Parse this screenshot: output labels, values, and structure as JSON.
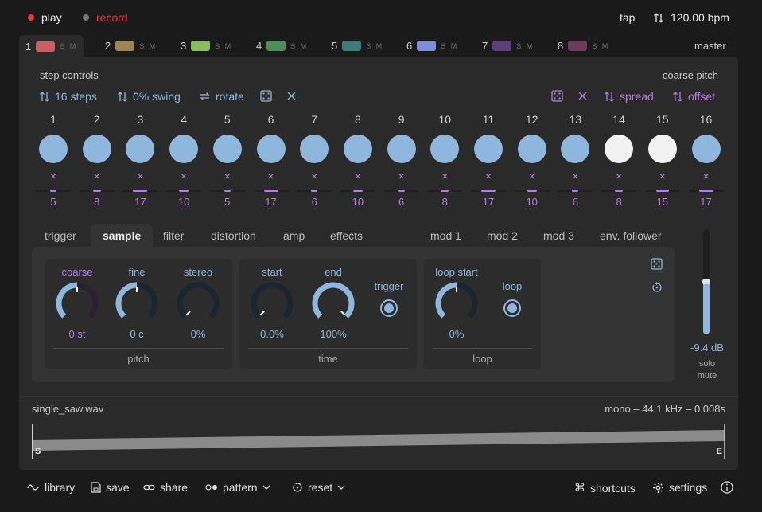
{
  "transport": {
    "play_label": "play",
    "record_label": "record",
    "tap_label": "tap",
    "bpm": "120.00 bpm",
    "colors": {
      "play_dot": "#e53935",
      "record_dot": "#777777",
      "record_text": "#e53935"
    }
  },
  "tracks": [
    {
      "num": "1",
      "color": "#c95f62",
      "sm": "S M"
    },
    {
      "num": "2",
      "color": "#9a8650",
      "sm": "S M"
    },
    {
      "num": "3",
      "color": "#8bbd5b",
      "sm": "S M"
    },
    {
      "num": "4",
      "color": "#4d8d5b",
      "sm": "S M"
    },
    {
      "num": "5",
      "color": "#3f7c79",
      "sm": "S M"
    },
    {
      "num": "6",
      "color": "#7d8dd8",
      "sm": "S M"
    },
    {
      "num": "7",
      "color": "#5c3f7a",
      "sm": "S M"
    },
    {
      "num": "8",
      "color": "#6b3d57",
      "sm": "S M"
    }
  ],
  "master_label": "master",
  "step_controls": {
    "title": "step controls",
    "steps_label": "16 steps",
    "swing_label": "0% swing",
    "rotate_label": "rotate",
    "coarse_pitch_title": "coarse pitch",
    "spread_label": "spread",
    "offset_label": "offset"
  },
  "steps": [
    {
      "num": "1",
      "underline": true,
      "active": false,
      "value": "5",
      "level": 0.2
    },
    {
      "num": "2",
      "underline": false,
      "active": false,
      "value": "8",
      "level": 0.25
    },
    {
      "num": "3",
      "underline": false,
      "active": false,
      "value": "17",
      "level": 0.45
    },
    {
      "num": "4",
      "underline": false,
      "active": false,
      "value": "10",
      "level": 0.3
    },
    {
      "num": "5",
      "underline": true,
      "active": false,
      "value": "5",
      "level": 0.2
    },
    {
      "num": "6",
      "underline": false,
      "active": false,
      "value": "17",
      "level": 0.45
    },
    {
      "num": "7",
      "underline": false,
      "active": false,
      "value": "6",
      "level": 0.2
    },
    {
      "num": "8",
      "underline": false,
      "active": false,
      "value": "10",
      "level": 0.3
    },
    {
      "num": "9",
      "underline": true,
      "active": false,
      "value": "6",
      "level": 0.2
    },
    {
      "num": "10",
      "underline": false,
      "active": false,
      "value": "8",
      "level": 0.25
    },
    {
      "num": "11",
      "underline": false,
      "active": false,
      "value": "17",
      "level": 0.45
    },
    {
      "num": "12",
      "underline": false,
      "active": false,
      "value": "10",
      "level": 0.3
    },
    {
      "num": "13",
      "underline": true,
      "active": false,
      "value": "6",
      "level": 0.2
    },
    {
      "num": "14",
      "underline": false,
      "active": true,
      "value": "8",
      "level": 0.25
    },
    {
      "num": "15",
      "underline": false,
      "active": true,
      "value": "15",
      "level": 0.4
    },
    {
      "num": "16",
      "underline": false,
      "active": false,
      "value": "17",
      "level": 0.45
    }
  ],
  "tabs_left": [
    "trigger",
    "sample",
    "filter",
    "distortion",
    "amp",
    "effects"
  ],
  "tabs_right": [
    "mod 1",
    "mod 2",
    "mod 3",
    "env. follower"
  ],
  "active_tab": "sample",
  "pitch_group": {
    "title": "pitch",
    "knobs": [
      {
        "label": "coarse",
        "value": "0 st",
        "level": 0.5
      },
      {
        "label": "fine",
        "value": "0 c",
        "level": 0.5
      },
      {
        "label": "stereo",
        "value": "0%",
        "level": 0.0
      }
    ]
  },
  "time_group": {
    "title": "time",
    "knobs": [
      {
        "label": "start",
        "value": "0.0%",
        "level": 0.0
      },
      {
        "label": "end",
        "value": "100%",
        "level": 1.0
      }
    ],
    "trigger_label": "trigger"
  },
  "loop_group": {
    "title": "loop",
    "knob": {
      "label": "loop start",
      "value": "0%",
      "level": 0.5
    },
    "toggle_label": "loop"
  },
  "volume": {
    "value": "-9.4 dB",
    "level": 0.5,
    "solo_label": "solo",
    "mute_label": "mute"
  },
  "sample_file": {
    "name": "single_saw.wav",
    "info": "mono – 44.1 kHz – 0.008s",
    "start_marker": "S",
    "end_marker": "E"
  },
  "footer": {
    "library_label": "library",
    "save_label": "save",
    "share_label": "share",
    "pattern_label": "pattern",
    "reset_label": "reset",
    "shortcuts_label": "shortcuts",
    "settings_label": "settings"
  }
}
